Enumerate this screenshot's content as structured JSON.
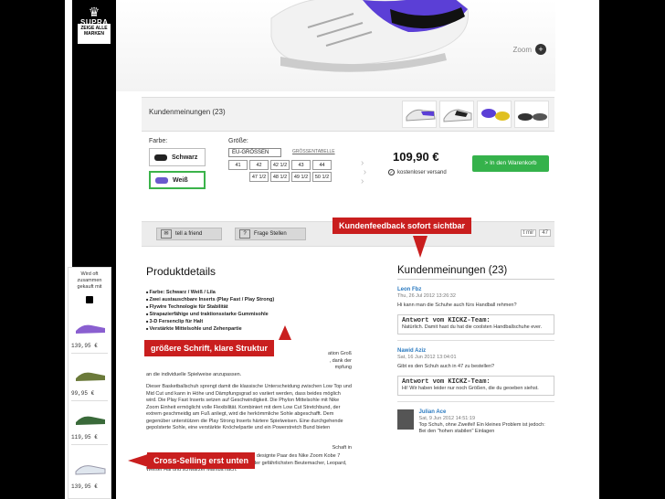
{
  "brand": {
    "logo_text": "SUPRA",
    "brand_button": "ZEIGE ALLE MARKEN"
  },
  "hero": {
    "zoom_label": "Zoom",
    "zoom_icon": "+"
  },
  "reviews_strip": {
    "title": "Kundenmeinungen (23)"
  },
  "options": {
    "color_label": "Farbe:",
    "colors": [
      {
        "label": "Schwarz",
        "swatch": "#222222",
        "selected": false
      },
      {
        "label": "Weiß",
        "swatch": "#6a5acd",
        "selected": true
      }
    ],
    "size_label": "Größe:",
    "size_select": "EU-GRÖSSEN",
    "size_table_link": "GRÖSSENTABELLE",
    "sizes_row1": [
      "41",
      "42",
      "42 1/2",
      "43",
      "44"
    ],
    "sizes_row2": [
      "47 1/2",
      "48 1/2",
      "49 1/2",
      "50 1/2"
    ],
    "price": "109,90 €",
    "shipping": "kostenloser versand",
    "cart_button": "> In den Warenkorb"
  },
  "actions": {
    "tell_friend": "tell a friend",
    "ask_question": "Frage Stellen",
    "like_text": "t mir",
    "like_count": "47"
  },
  "callouts": {
    "feedback": "Kundenfeedback sofort sichtbar",
    "font": "größere Schrift, klare Struktur",
    "cross_selling": "Cross-Selling erst unten"
  },
  "sidebar": {
    "title": "Wird oft zusammen gekauft mit",
    "prices": [
      "139,95 €",
      "99,95 €",
      "119,95 €",
      "139,95 €"
    ]
  },
  "details": {
    "title": "Produktdetails",
    "features": [
      "Farbe: Schwarz / Weiß / Lila",
      "Zwei austauschbare Inserts (Play Fast / Play Strong)",
      "Flywire Technologie für Stabilität",
      "Strapazierfähige und traktionsstarke Gummisohle",
      "3-D Fersenclip für Halt",
      "Verstärkte Mittelsohle und Zehenpartie"
    ],
    "text_fragments": [
      "ation Groß",
      ", dank der",
      "mpfung",
      "an die individuelle Spielweise anzupassen."
    ],
    "paragraph": "Dieser Basketballschuh sprengt damit die klassische Unterscheidung zwischen Low Top und Mid Cut und kann in Höhe und Dämpfungsgrad so variiert werden, dass beides möglich wird. Die Play Fast Inserts setzen auf Geschwindigkeit. Die Phylon Mittelsohle mit Nike Zoom Einheit ermöglicht volle Flexibilität. Kombiniert mit dem Low Cut Stretchbund, der extrem geschmeidig am Fuß anliegt, wird die herkömmliche Sohle abgeschafft. Dem gegenüber unterstützen die Play Strong Inserts härtere Spielweisen. Eine durchgehende gepolsterte Sohle, eine verstärkte Knöchelpartie und ein Powerstretch Bund bieten",
    "text_end_fragment": "Schaft in",
    "paragraph2": "angriffslustige Spielweise wird durch das auffällig designte Paar des Nike Zoom Kobe 7 Supreme Tribut gezollt und ahmt das Aussehen der gefährlichsten Beutemacher, Leopard, Weißer Hai und schwarzer Mamba nach."
  },
  "customer_reviews": {
    "title": "Kundenmeinungen (23)",
    "items": [
      {
        "name": "Leon Fbz",
        "date": "Thu, 26 Jul 2012 13:26:32",
        "text": "Hi kann man die Schuhe auch fürs Handball rehmen?",
        "answer_title": "Antwort vom KICKZ-Team:",
        "answer": "Natürlich. Damit hast du hat die coolsten Handballschuhe ever."
      },
      {
        "name": "Nawid Aziz",
        "date": "Sat, 16 Jun 2012 13:04:01",
        "text": "Gibt es den Schuh auch in 47 zu bestellen?",
        "answer_title": "Antwort vom KICKZ-Team:",
        "answer": "Hi! Wir haben leider nur noch Größen, die du geoeben siehst."
      },
      {
        "name": "Julian Ace",
        "date": "Sat, 9 Jun 2012 14:51:19",
        "text": "Top Schuh, ohne Zweifel! Ein kleines Problem ist jedoch: Bei den \"hohen stabilen\" Einlagen"
      }
    ]
  }
}
